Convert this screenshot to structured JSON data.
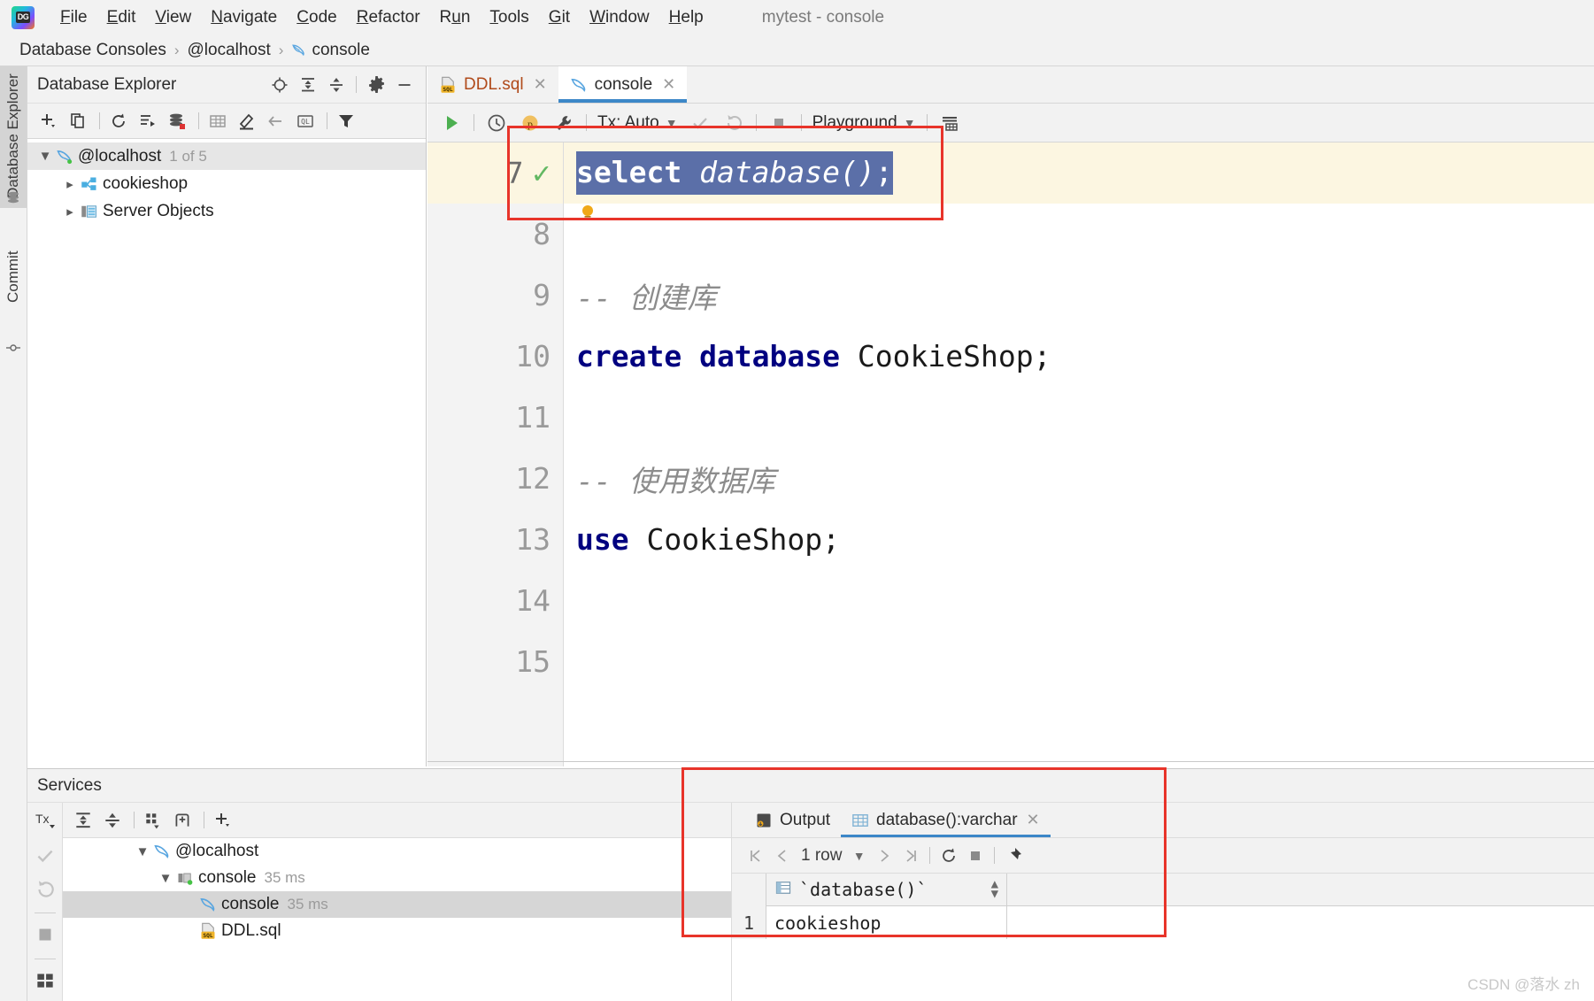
{
  "window": {
    "title": "mytest - console",
    "logo_text": "DG"
  },
  "menu": {
    "items": [
      {
        "label": "File",
        "mnemonic": "F"
      },
      {
        "label": "Edit",
        "mnemonic": "E"
      },
      {
        "label": "View",
        "mnemonic": "V"
      },
      {
        "label": "Navigate",
        "mnemonic": "N"
      },
      {
        "label": "Code",
        "mnemonic": "C"
      },
      {
        "label": "Refactor",
        "mnemonic": "R"
      },
      {
        "label": "Run",
        "mnemonic": "u"
      },
      {
        "label": "Tools",
        "mnemonic": "T"
      },
      {
        "label": "Git",
        "mnemonic": "G"
      },
      {
        "label": "Window",
        "mnemonic": "W"
      },
      {
        "label": "Help",
        "mnemonic": "H"
      }
    ]
  },
  "breadcrumb": {
    "items": [
      "Database Consoles",
      "@localhost",
      "console"
    ],
    "separator": "›",
    "leaf_icon": "dolphin-icon"
  },
  "left_rail": {
    "items": [
      {
        "label": "Database Explorer",
        "icon": "database-icon",
        "active": true
      },
      {
        "label": "Commit",
        "icon": "commit-icon",
        "active": false
      }
    ]
  },
  "db_explorer": {
    "title": "Database Explorer",
    "header_icons": [
      "locate-icon",
      "expand-all-icon",
      "collapse-all-icon",
      "gear-icon",
      "minimize-icon"
    ],
    "toolbar_icons": [
      "add-icon",
      "copy-icon",
      "refresh-icon",
      "sync-tables-icon",
      "data-source-icon",
      "table-icon",
      "edit-icon",
      "jump-to-icon",
      "query-console-icon",
      "filter-icon"
    ],
    "tree": [
      {
        "label": "@localhost",
        "badge": "1 of 5",
        "icon": "dolphin-icon",
        "expanded": true,
        "level": 0,
        "selected": true
      },
      {
        "label": "cookieshop",
        "badge": "",
        "icon": "schema-icon",
        "expanded": false,
        "level": 1,
        "selected": false
      },
      {
        "label": "Server Objects",
        "badge": "",
        "icon": "server-objects-icon",
        "expanded": false,
        "level": 1,
        "selected": false
      }
    ]
  },
  "editor": {
    "tabs": [
      {
        "label": "DDL.sql",
        "icon": "sql-file-icon",
        "active": false,
        "closable": true
      },
      {
        "label": "console",
        "icon": "dolphin-icon",
        "active": true,
        "closable": true
      }
    ],
    "toolbar": {
      "run_icon": "run-icon",
      "history_icon": "history-icon",
      "parameters_icon": "parameters-icon",
      "tools_icon": "wrench-icon",
      "tx_label": "Tx: Auto",
      "commit_icon": "commit-check-icon",
      "rollback_icon": "rollback-icon",
      "stop_icon": "stop-icon",
      "schema_label": "Playground",
      "output_icon": "output-options-icon"
    },
    "lines": [
      {
        "number": "7",
        "current": true,
        "has_check": true,
        "selected_text": "select database();",
        "segments": [
          {
            "text": "select ",
            "style": "kw-sel"
          },
          {
            "text": "database()",
            "style": "fn-sel"
          },
          {
            "text": ";",
            "style": "kw-sel"
          }
        ]
      },
      {
        "number": "8",
        "current": false,
        "has_check": false,
        "segments": []
      },
      {
        "number": "9",
        "current": false,
        "has_check": false,
        "segments": [
          {
            "text": "-- 创建库",
            "style": "cmt"
          }
        ]
      },
      {
        "number": "10",
        "current": false,
        "has_check": false,
        "segments": [
          {
            "text": "create database ",
            "style": "kw"
          },
          {
            "text": "CookieShop;",
            "style": "plain"
          }
        ]
      },
      {
        "number": "11",
        "current": false,
        "has_check": false,
        "segments": []
      },
      {
        "number": "12",
        "current": false,
        "has_check": false,
        "segments": [
          {
            "text": "-- 使用数据库",
            "style": "cmt"
          }
        ]
      },
      {
        "number": "13",
        "current": false,
        "has_check": false,
        "segments": [
          {
            "text": "use ",
            "style": "kw"
          },
          {
            "text": "CookieShop;",
            "style": "plain"
          }
        ]
      },
      {
        "number": "14",
        "current": false,
        "has_check": false,
        "segments": []
      },
      {
        "number": "15",
        "current": false,
        "has_check": false,
        "segments": []
      }
    ],
    "intention_bulb": "lightbulb-icon"
  },
  "services": {
    "title": "Services",
    "rail_icons": [
      "tx-icon",
      "commit-check-icon",
      "rollback-icon",
      "stop-icon",
      "grid-icon"
    ],
    "toolbar_icons": [
      "expand-all-icon",
      "collapse-all-icon",
      "group-icon",
      "add-frame-icon",
      "add-icon"
    ],
    "tree": [
      {
        "label": "@localhost",
        "meta": "",
        "icon": "dolphin-icon",
        "level": 0,
        "expanded": true,
        "selected": false
      },
      {
        "label": "console",
        "meta": "35 ms",
        "icon": "session-icon",
        "level": 1,
        "expanded": true,
        "selected": false
      },
      {
        "label": "console",
        "meta": "35 ms",
        "icon": "dolphin-icon",
        "level": 2,
        "expanded": null,
        "selected": true
      },
      {
        "label": "DDL.sql",
        "meta": "",
        "icon": "sql-file-icon",
        "level": 2,
        "expanded": null,
        "selected": false
      }
    ]
  },
  "result": {
    "tabs": [
      {
        "label": "Output",
        "icon": "output-icon",
        "active": false,
        "closable": false
      },
      {
        "label": "database():varchar",
        "icon": "table-icon",
        "active": true,
        "closable": true
      }
    ],
    "toolbar": {
      "first_icon": "first-page-icon",
      "prev_icon": "prev-page-icon",
      "row_count": "1 row",
      "next_icon": "next-page-icon",
      "last_icon": "last-page-icon",
      "reload_icon": "refresh-icon",
      "stop_icon": "stop-icon",
      "pin_icon": "pin-icon"
    },
    "grid": {
      "columns": [
        "`database()`"
      ],
      "rows": [
        {
          "num": "1",
          "values": [
            "cookieshop"
          ]
        }
      ]
    }
  },
  "annotations": {
    "highlight_color": "#e8342a",
    "boxes": [
      "editor-statement-box",
      "result-panel-box"
    ]
  },
  "watermark": {
    "text": "CSDN @落水 zh"
  },
  "colors": {
    "accent": "#3c87c8",
    "keyword": "#000080",
    "selection": "#5b6fa8",
    "current_line": "#fcf6e1",
    "annotation": "#e8342a",
    "success": "#62b862"
  }
}
